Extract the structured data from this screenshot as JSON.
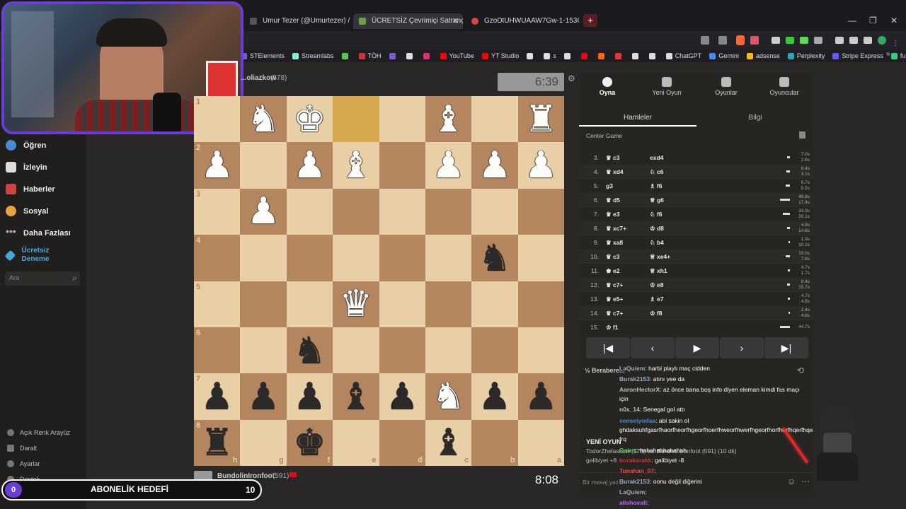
{
  "browser": {
    "tabs": [
      {
        "title": "Umur Tezer (@Umurtezer) / X",
        "color": "#555"
      },
      {
        "title": "ÜCRETSİZ Çevrimiçi Satranç Oyna",
        "color": "#6da04a"
      },
      {
        "title": "GzoDtUHWUAAW7Gw-1-1536x1536",
        "color": "#d44"
      }
    ],
    "new_tab": "+",
    "bookmarks": [
      {
        "label": "STElements",
        "color": "#7b5cd6"
      },
      {
        "label": "Streamlabs",
        "color": "#80f5d2"
      },
      {
        "label": "",
        "color": "#5c5"
      },
      {
        "label": "TÖH",
        "color": "#c33"
      },
      {
        "label": "",
        "color": "#7b5cd6"
      },
      {
        "label": "",
        "color": "#ddd"
      },
      {
        "label": "",
        "color": "#e1306c"
      },
      {
        "label": "YouTube",
        "color": "#f00"
      },
      {
        "label": "YT Studio",
        "color": "#f00"
      },
      {
        "label": "",
        "color": "#ddd"
      },
      {
        "label": "s",
        "color": "#ddd"
      },
      {
        "label": "",
        "color": "#ddd"
      },
      {
        "label": "",
        "color": "#e50914"
      },
      {
        "label": "",
        "color": "#f60"
      },
      {
        "label": "",
        "color": "#e33"
      },
      {
        "label": "",
        "color": "#ddd"
      },
      {
        "label": "",
        "color": "#ddd"
      },
      {
        "label": "ChatGPT",
        "color": "#ddd"
      },
      {
        "label": "Gemini",
        "color": "#4a8af4"
      },
      {
        "label": "adsense",
        "color": "#fbbc05"
      },
      {
        "label": "Perplexity",
        "color": "#2ab"
      },
      {
        "label": "Stripe Express",
        "color": "#635bff"
      },
      {
        "label": "futbin",
        "color": "#3c8"
      }
    ],
    "more": "»"
  },
  "sidebar": {
    "items": [
      {
        "label": "Öğren",
        "color": "#4a8ad4"
      },
      {
        "label": "İzleyin",
        "color": "#ddd"
      },
      {
        "label": "Haberler",
        "color": "#c44"
      },
      {
        "label": "Sosyal",
        "color": "#e8a33c"
      },
      {
        "label": "Daha Fazlası",
        "color": "#999"
      },
      {
        "label": "Ücretsiz Deneme",
        "color": "#4ad"
      }
    ],
    "search_placeholder": "Ara",
    "bottom": [
      "Açık Renk Arayüz",
      "Daralt",
      "Ayarlar",
      "Destek"
    ]
  },
  "game": {
    "top_player": {
      "name": "...oliazkow",
      "rating": "(578)",
      "clock": "6:39"
    },
    "bottom_player": {
      "name": "BundolinIronfoot",
      "rating": "(591)",
      "clock": "8:08"
    },
    "ranks": [
      "1",
      "2",
      "3",
      "4",
      "5",
      "6",
      "7",
      "8"
    ],
    "files": [
      "h",
      "g",
      "f",
      "e",
      "d",
      "c",
      "b",
      "a"
    ],
    "board": [
      [
        "",
        "wN",
        "wK",
        "hl",
        "",
        "wB",
        "",
        "wR"
      ],
      [
        "wP",
        "",
        "wP",
        "wB",
        "",
        "wP",
        "wP",
        "wP"
      ],
      [
        "",
        "wP",
        "",
        "",
        "",
        "",
        "",
        ""
      ],
      [
        "",
        "",
        "",
        "",
        "",
        "",
        "bN",
        ""
      ],
      [
        "",
        "",
        "",
        "wQ",
        "",
        "",
        "",
        ""
      ],
      [
        "",
        "",
        "bN",
        "",
        "",
        "",
        "",
        ""
      ],
      [
        "bP",
        "bP",
        "bP",
        "bB",
        "bP",
        "wN",
        "bP",
        "bP"
      ],
      [
        "bR",
        "",
        "bK",
        "",
        "",
        "bB",
        "",
        ""
      ]
    ]
  },
  "panel": {
    "tabs": [
      "Oyna",
      "Yeni Oyun",
      "Oyunlar",
      "Oyuncular"
    ],
    "subtabs": [
      "Hamleler",
      "Bilgi"
    ],
    "opening": "Center Game",
    "moves": [
      {
        "n": "3.",
        "w": "♛ c3",
        "b": "exd4",
        "tw": "7.0s",
        "tb": "2.6s",
        "bar": 4
      },
      {
        "n": "4.",
        "w": "♛ xd4",
        "b": "♘ c6",
        "tw": "8.4s",
        "tb": "3.1s",
        "bar": 5
      },
      {
        "n": "5.",
        "w": "g3",
        "b": "♗ f6",
        "tw": "9.7s",
        "tb": "5.5s",
        "bar": 6
      },
      {
        "n": "6.",
        "w": "♛ d5",
        "b": "♕ g6",
        "tw": "49.8s",
        "tb": "17.4s",
        "bar": 14
      },
      {
        "n": "7.",
        "w": "♛ e3",
        "b": "♘ f6",
        "tw": "33.9s",
        "tb": "20.1s",
        "bar": 10
      },
      {
        "n": "8.",
        "w": "♛ xc7+",
        "b": "♔ d8",
        "tw": "4.9s",
        "tb": "14.8s",
        "bar": 4
      },
      {
        "n": "9.",
        "w": "♛ xa8",
        "b": "♘ b4",
        "tw": "1.9s",
        "tb": "10.1s",
        "bar": 2
      },
      {
        "n": "10.",
        "w": "♛ c3",
        "b": "♕ xe4+",
        "tw": "19.0s",
        "tb": "7.8s",
        "bar": 6
      },
      {
        "n": "11.",
        "w": "♚ e2",
        "b": "♕ xh1",
        "tw": "4.7s",
        "tb": "1.7s",
        "bar": 3
      },
      {
        "n": "12.",
        "w": "♛ c7+",
        "b": "♔ e8",
        "tw": "8.4s",
        "tb": "15.7s",
        "bar": 4
      },
      {
        "n": "13.",
        "w": "♛ e5+",
        "b": "♗ e7",
        "tw": "4.7s",
        "tb": "4.8s",
        "bar": 3
      },
      {
        "n": "14.",
        "w": "♛ c7+",
        "b": "♔ f8",
        "tw": "2.4s",
        "tb": "4.8s",
        "bar": 2
      },
      {
        "n": "15.",
        "w": "♔ f1",
        "b": "",
        "tw": "44.7s",
        "tb": "",
        "bar": 14
      }
    ],
    "draw_label": "Berabere...",
    "chat_placeholder": "Bir mesaj yaz..."
  },
  "chat": [
    {
      "user": "LaQuiem",
      "text": ": harbi playlı maç cidden",
      "color": "#aab"
    },
    {
      "user": "Burak2153",
      "text": ": atını yee da",
      "color": "#9ab"
    },
    {
      "user": "AaronHectorX",
      "text": ": az önce bana boş info diyen eleman kimdi fas maçı",
      "color": "#bbb"
    },
    {
      "user": "",
      "text": "için",
      "color": "#fff"
    },
    {
      "user": "n0x_14",
      "text": ": Senegal gol attı",
      "color": "#bbb"
    },
    {
      "user": "senseiyodaa",
      "text": ": abi sakin ol",
      "color": "#4a8ad4"
    },
    {
      "user": "",
      "text": "ghdaksuhfgasrfhaorfheorfhgeorfhoerfhweorfhwerfhgeorfhorfhorfhqerfhqe",
      "color": "#fff"
    },
    {
      "user": "",
      "text": "frq",
      "color": "#fff"
    },
    {
      "user": "Golos",
      "text": ": hahahahhahahah",
      "color": "#5c5"
    },
    {
      "user": "borakarakk",
      "text": ": galibiyet -8",
      "color": "#c33"
    },
    {
      "user": "Tunahan_07",
      "text": ":",
      "color": "#e44"
    },
    {
      "user": "Burak2153",
      "text": ": oonu değil diğerini",
      "color": "#9ab"
    },
    {
      "user": "LaQuiem",
      "text": ":",
      "color": "#aab"
    },
    {
      "user": "alishovali",
      "text": ":",
      "color": "#b6f"
    }
  ],
  "game_over": {
    "title": "YENİ OYUN",
    "line1": "TodorZhelaskow (578) vs. BundolinIronfoot (591) (10 dk)",
    "line2": "galibiyet +8"
  },
  "goal": {
    "count": "0",
    "label": "ABONELİK HEDEFİ",
    "target": "10"
  },
  "colors": {
    "accent": "#6a3dd8",
    "light_square": "#e8cfa6",
    "dark_square": "#b3865f"
  }
}
